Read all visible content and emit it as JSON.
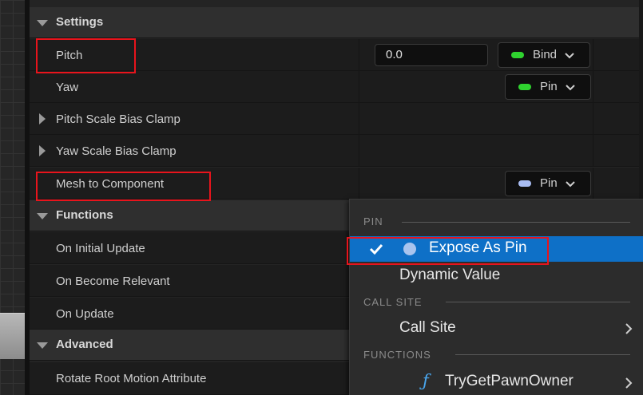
{
  "colors": {
    "accent_blue": "#0e70c7",
    "bool_pin_green": "#2fd32f",
    "object_pin_blue": "#a9bdf3",
    "highlight_red": "#e8141c",
    "function_icon_blue": "#4aa8f0"
  },
  "sections": {
    "settings": "Settings",
    "functions": "Functions",
    "advanced": "Advanced"
  },
  "properties": {
    "pitch": {
      "label": "Pitch",
      "value": "0.0",
      "button": "Bind"
    },
    "yaw": {
      "label": "Yaw",
      "button": "Pin"
    },
    "pitch_scale_bias_clamp": {
      "label": "Pitch Scale Bias Clamp"
    },
    "yaw_scale_bias_clamp": {
      "label": "Yaw Scale Bias Clamp"
    },
    "mesh_to_component": {
      "label": "Mesh to Component",
      "button": "Pin"
    },
    "on_initial_update": {
      "label": "On Initial Update"
    },
    "on_become_relevant": {
      "label": "On Become Relevant"
    },
    "on_update": {
      "label": "On Update"
    },
    "rotate_root_motion_attribute": {
      "label": "Rotate Root Motion Attribute"
    }
  },
  "menu": {
    "pin_header": "PIN",
    "expose_as_pin": "Expose As Pin",
    "dynamic_value": "Dynamic Value",
    "call_site_header": "CALL SITE",
    "call_site": "Call Site",
    "functions_header": "FUNCTIONS",
    "try_get_pawn_owner": "TryGetPawnOwner",
    "function_icon_glyph": "ƒ",
    "icons": [
      "checkmark-icon",
      "pin-dot-icon",
      "chevron-right-icon",
      "function-icon"
    ]
  }
}
